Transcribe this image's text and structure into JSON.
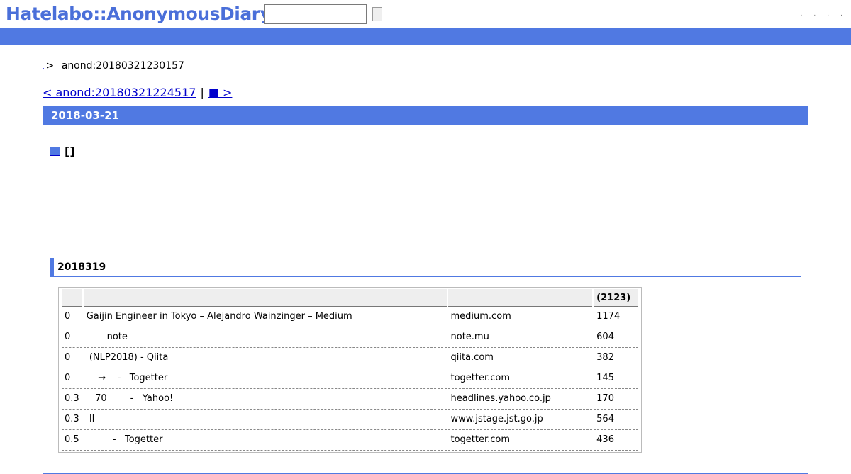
{
  "header": {
    "logo": "Hatelabo::AnonymousDiary",
    "search": {
      "value": "",
      "placeholder": ""
    },
    "search_button_label": "",
    "links": [
      ".",
      ".",
      ".",
      "."
    ]
  },
  "breadcrumb": {
    "home": ".",
    "separator": ">",
    "current": "anond:20180321230157"
  },
  "pager": {
    "prev": "< anond:20180321224517",
    "divider": "|",
    "next": "■ >"
  },
  "day": {
    "date": "2018-03-21",
    "entry_title": "[]",
    "section_heading": "2018319"
  },
  "table": {
    "headers": [
      "",
      "",
      "",
      "(2123)"
    ],
    "rows": [
      [
        "0",
        "Gaijin Engineer in Tokyo – Alejandro Wainzinger – Medium",
        "medium.com",
        "1174"
      ],
      [
        "0",
        "       note",
        "note.mu",
        "604"
      ],
      [
        "0",
        " (NLP2018) - Qiita",
        "qiita.com",
        "382"
      ],
      [
        "0",
        "    →    -   Togetter",
        "togetter.com",
        "145"
      ],
      [
        "0.3",
        "   70        -   Yahoo!",
        "headlines.yahoo.co.jp",
        "170"
      ],
      [
        "0.3",
        " II",
        "www.jstage.jst.go.jp",
        "564"
      ],
      [
        "0.5",
        "         -   Togetter",
        "togetter.com",
        "436"
      ]
    ]
  },
  "colors": {
    "accent": "#5079e2",
    "logo": "#4a6fd9",
    "link": "#0000cc"
  }
}
